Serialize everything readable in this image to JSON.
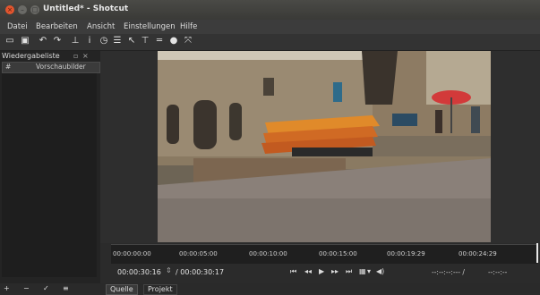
{
  "window": {
    "title": "Untitled* - Shotcut"
  },
  "menubar": {
    "items": [
      "Datei",
      "Bearbeiten",
      "Ansicht",
      "Einstellungen",
      "Hilfe"
    ]
  },
  "playlist": {
    "title": "Wiedergabeliste",
    "col_index": "#",
    "col_thumbs": "Vorschaubilder"
  },
  "timeline": {
    "ticks": [
      "00:00:00:00",
      "00:00:05:00",
      "00:00:10:00",
      "00:00:15:00",
      "00:00:19:29",
      "00:00:24:29"
    ]
  },
  "transport": {
    "current": "00:00:30:16",
    "total": "/ 00:00:30:17",
    "in_point": "--:--:--:--- /",
    "duration": "--:--:--"
  },
  "tabs": {
    "source": "Quelle",
    "project": "Projekt"
  }
}
